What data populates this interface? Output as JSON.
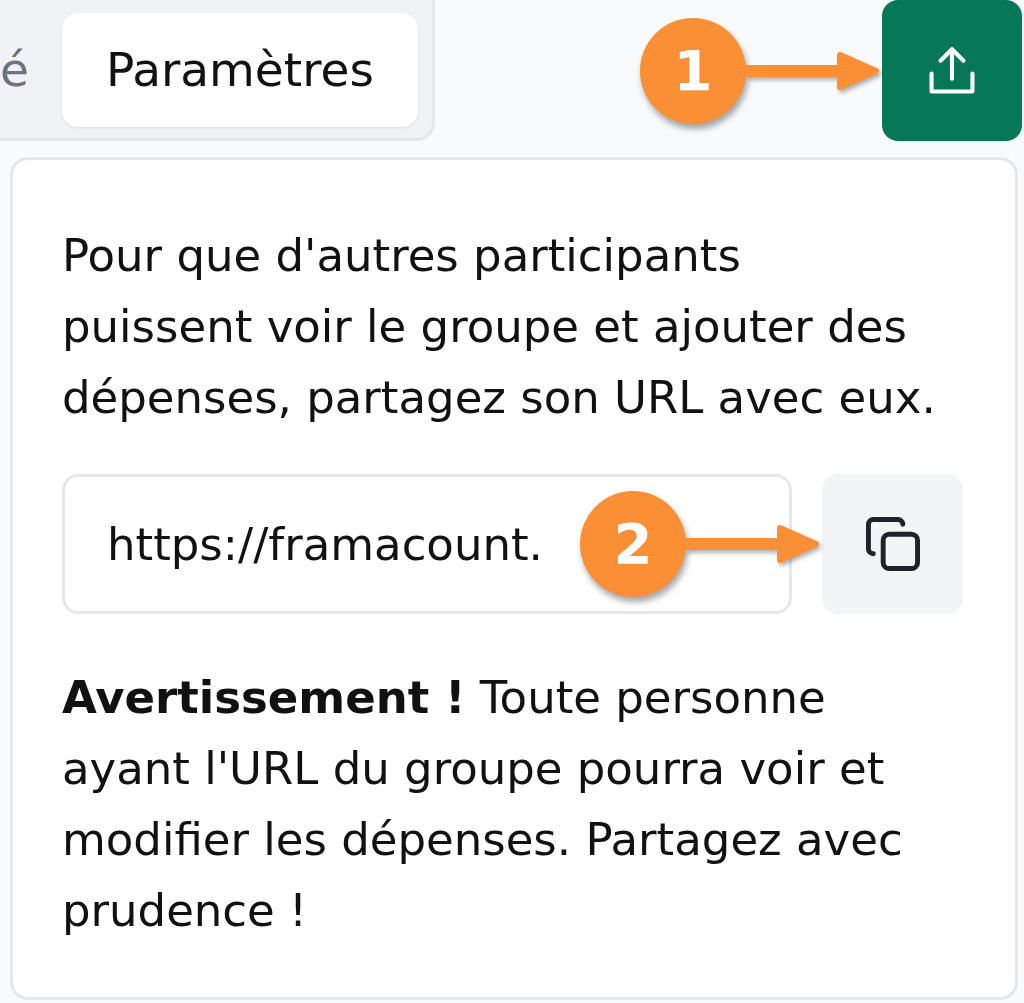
{
  "tabs": [
    {
      "label": "é",
      "selected": false
    },
    {
      "label": "Paramètres",
      "selected": true
    }
  ],
  "share_button": {
    "callout": "1"
  },
  "share_panel": {
    "intro": "Pour que d'autres participants puissent voir le groupe et ajouter des dépenses, partagez son URL avec eux.",
    "url_field": {
      "value": "https://framacount."
    },
    "copy_button": {
      "callout": "2"
    },
    "warning": "**Avertissement !** Toute personne ayant l'URL du groupe pourra voir et modifier les dépenses. Partagez avec prudence !"
  }
}
